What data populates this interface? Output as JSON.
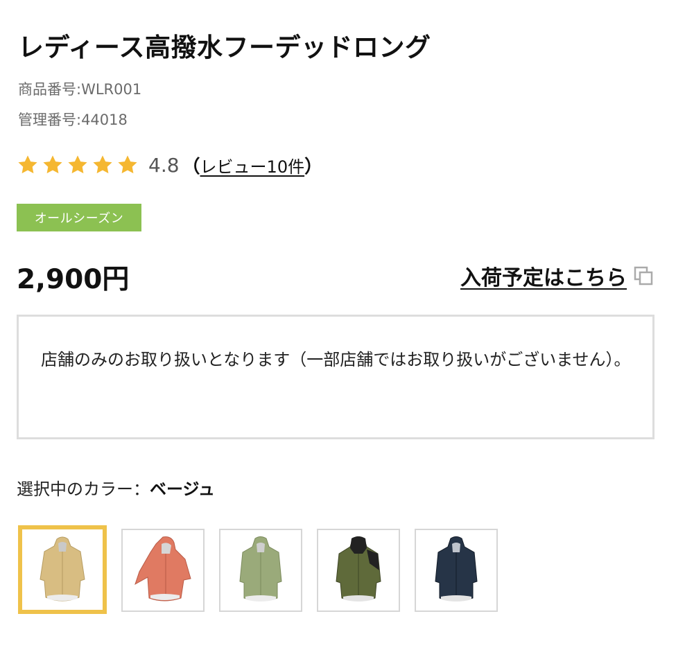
{
  "product": {
    "title": "レディース高撥水フーデッドロング",
    "item_number": "商品番号:WLR001",
    "control_number": "管理番号:44018"
  },
  "rating": {
    "stars": 5,
    "value": "4.8",
    "open_paren": "（",
    "review_link": "レビュー10件",
    "close_paren": "）",
    "star_color": "#f5b731"
  },
  "season_tag": {
    "label": "オールシーズン",
    "color": "#8cc152"
  },
  "price": "2,900円",
  "arrival_link": {
    "label": "入荷予定はこちら",
    "icon": "external-link-icon"
  },
  "notice": "店舗のみのお取り扱いとなります（一部店舗ではお取り扱いがございません）。",
  "color_selection": {
    "label": "選択中のカラー：",
    "selected": "ベージュ",
    "highlight_color": "#efc24a",
    "swatches": [
      {
        "name": "beige",
        "color": "#d8bd82",
        "selected": true
      },
      {
        "name": "coral",
        "color": "#e07a62",
        "selected": false
      },
      {
        "name": "khaki",
        "color": "#9aaa7a",
        "selected": false
      },
      {
        "name": "olive-black",
        "color": "#5f6a3a",
        "selected": false
      },
      {
        "name": "navy",
        "color": "#263447",
        "selected": false
      }
    ]
  }
}
